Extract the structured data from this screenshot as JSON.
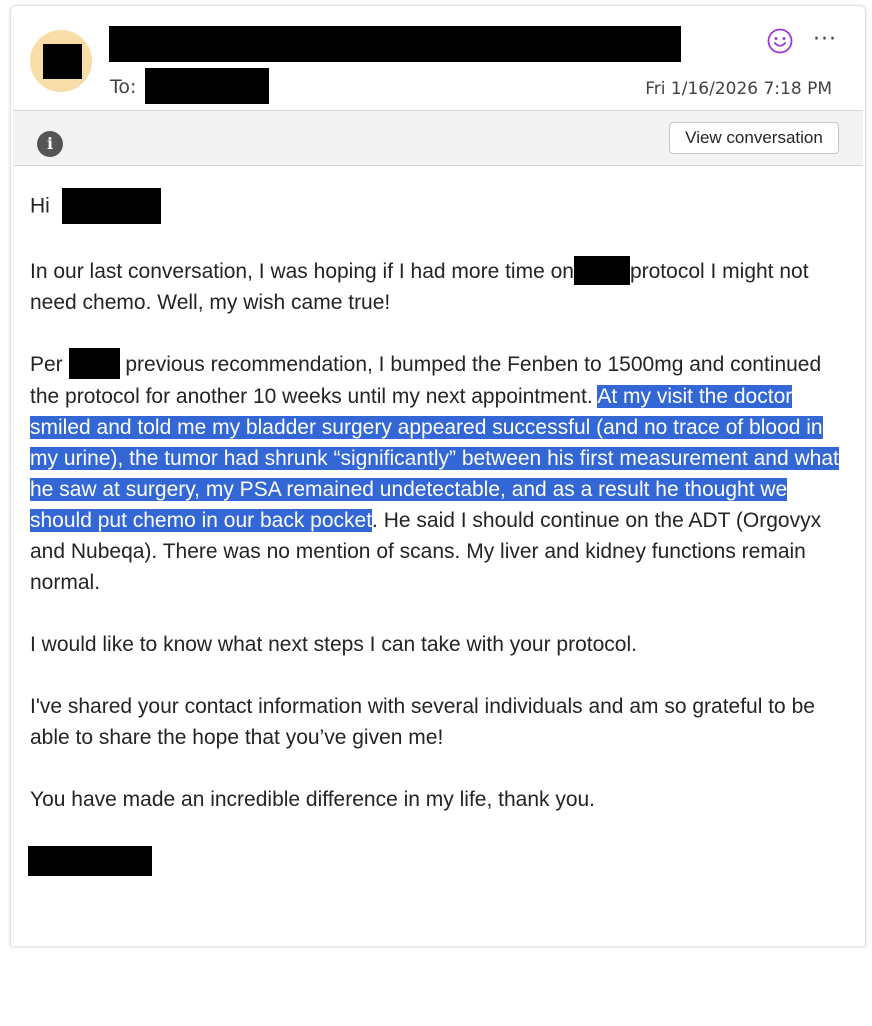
{
  "header": {
    "to_label": "To:",
    "date": "Fri 1/16/2026 7:18 PM",
    "emoji_icon": "smiley-icon",
    "more_icon": "more-options-icon",
    "more_glyph": "···"
  },
  "infobar": {
    "info_icon": "info-icon",
    "info_glyph": "i",
    "view_conversation_label": "View conversation"
  },
  "message": {
    "greeting": "Hi",
    "p1_a": "In our last conversation, I was hoping if I had more time on",
    "p1_b": "protocol I might not need chemo.  Well, my wish came true!",
    "p2_a": "Per",
    "p2_b": "previous recommendation, I bumped the Fenben to 1500mg and continued the protocol for another 10 weeks until my next appointment.",
    "p2_highlighted": "At my visit the doctor smiled and told me my bladder surgery appeared successful (and no trace of blood in my urine),  the tumor had shrunk “significantly”  between his first measurement and what he saw at surgery, my PSA remained undetectable, and as a result he thought we should put chemo in our back pocket",
    "p2_c": ".  He said I should continue on the ADT (Orgovyx and Nubeqa).  There was no mention of scans.  My liver and kidney functions remain normal.",
    "p3": "I would like to know what next steps I can take with your protocol.",
    "p4": "I've shared your contact information with several individuals and am so grateful to be able to share the hope that you’ve given me!",
    "p5": "You have made an incredible difference in my life, thank you."
  },
  "colors": {
    "avatar_bg": "#f8dea6",
    "selection_highlight": "#3367d6",
    "emoji_icon": "#9a3ad8",
    "redaction": "#000000"
  }
}
